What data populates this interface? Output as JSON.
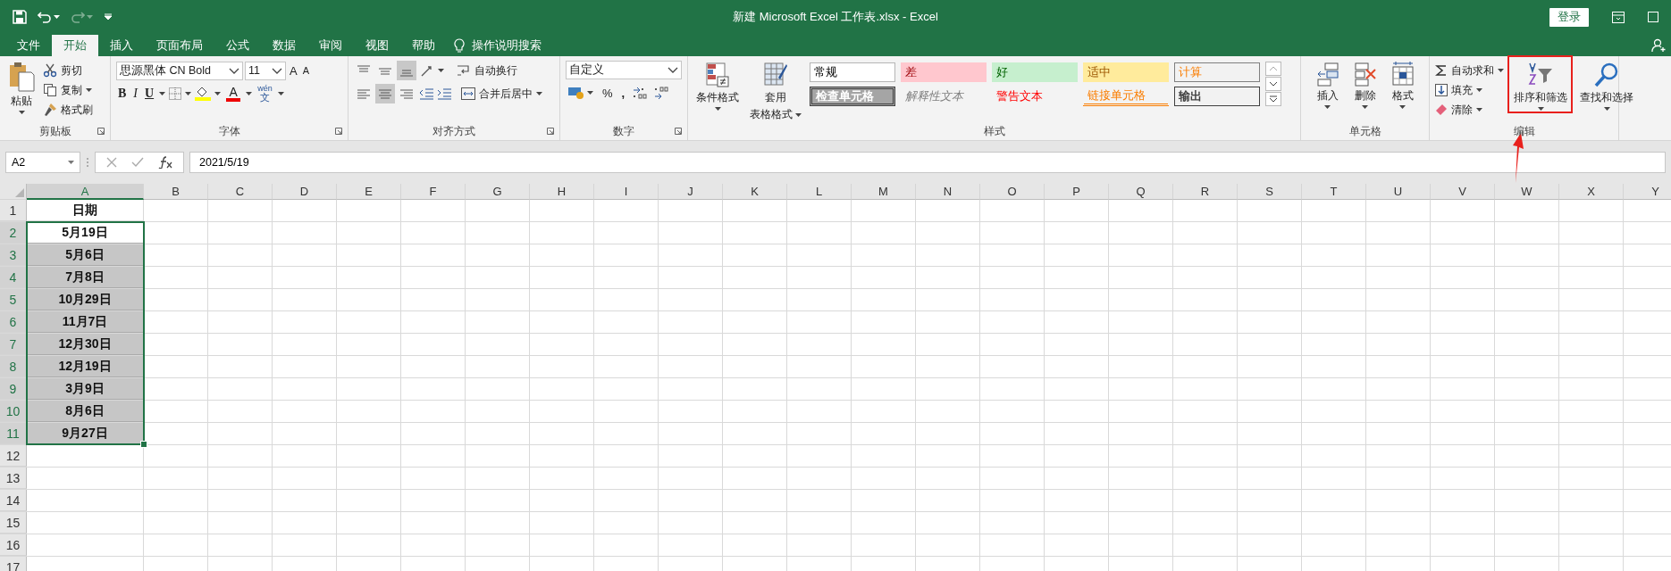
{
  "window": {
    "title": "新建 Microsoft Excel 工作表.xlsx  -  Excel",
    "sign_in": "登录"
  },
  "tabs": [
    {
      "label": "文件",
      "selected": false
    },
    {
      "label": "开始",
      "selected": true
    },
    {
      "label": "插入",
      "selected": false
    },
    {
      "label": "页面布局",
      "selected": false
    },
    {
      "label": "公式",
      "selected": false
    },
    {
      "label": "数据",
      "selected": false
    },
    {
      "label": "审阅",
      "selected": false
    },
    {
      "label": "视图",
      "selected": false
    },
    {
      "label": "帮助",
      "selected": false
    }
  ],
  "tell_me": "操作说明搜索",
  "ribbon": {
    "clipboard": {
      "paste": "粘贴",
      "cut": "剪切",
      "copy": "复制",
      "format_painter": "格式刷",
      "label": "剪贴板"
    },
    "font": {
      "font_name": "思源黑体 CN Bold",
      "font_size": "11",
      "grow": "A",
      "shrink": "A",
      "bold": "B",
      "italic": "I",
      "underline": "U",
      "font_color": "A",
      "phonetic_top": "wén",
      "phonetic_bottom": "文",
      "label": "字体"
    },
    "alignment": {
      "vertical": [
        {
          "selected": false
        },
        {
          "selected": false
        },
        {
          "selected": true
        }
      ],
      "horizontal": [
        {
          "selected": false
        },
        {
          "selected": true
        },
        {
          "selected": false
        }
      ],
      "wrap_text": "自动换行",
      "merge_center": "合并后居中",
      "label": "对齐方式"
    },
    "number": {
      "format": "自定义",
      "percent": "%",
      "comma": ",",
      "label": "数字"
    },
    "styles": {
      "conditional": "条件格式",
      "table_top": "套用",
      "table_bottom": "表格格式",
      "label": "样式",
      "cells": [
        {
          "label": "常规",
          "kind": "normal"
        },
        {
          "label": "差",
          "kind": "bad"
        },
        {
          "label": "好",
          "kind": "good"
        },
        {
          "label": "适中",
          "kind": "neutral"
        },
        {
          "label": "计算",
          "kind": "calc"
        },
        {
          "label": "检查单元格",
          "kind": "check"
        },
        {
          "label": "解释性文本",
          "kind": "explanatory"
        },
        {
          "label": "警告文本",
          "kind": "warning"
        },
        {
          "label": "链接单元格",
          "kind": "linked"
        },
        {
          "label": "输出",
          "kind": "output"
        }
      ]
    },
    "cells": {
      "insert": "插入",
      "delete": "删除",
      "format": "格式",
      "label": "单元格"
    },
    "editing": {
      "autosum": "自动求和",
      "fill": "填充",
      "clear": "清除",
      "sort_filter": "排序和筛选",
      "find_select": "查找和选择",
      "label": "编辑"
    }
  },
  "formula_bar": {
    "name_box": "A2",
    "formula": "2021/5/19"
  },
  "grid": {
    "columns": [
      {
        "label": "A",
        "selected": true
      },
      {
        "label": "B",
        "selected": false
      },
      {
        "label": "C",
        "selected": false
      },
      {
        "label": "D",
        "selected": false
      },
      {
        "label": "E",
        "selected": false
      },
      {
        "label": "F",
        "selected": false
      },
      {
        "label": "G",
        "selected": false
      },
      {
        "label": "H",
        "selected": false
      },
      {
        "label": "I",
        "selected": false
      },
      {
        "label": "J",
        "selected": false
      },
      {
        "label": "K",
        "selected": false
      },
      {
        "label": "L",
        "selected": false
      },
      {
        "label": "M",
        "selected": false
      },
      {
        "label": "N",
        "selected": false
      },
      {
        "label": "O",
        "selected": false
      },
      {
        "label": "P",
        "selected": false
      },
      {
        "label": "Q",
        "selected": false
      },
      {
        "label": "R",
        "selected": false
      },
      {
        "label": "S",
        "selected": false
      },
      {
        "label": "T",
        "selected": false
      },
      {
        "label": "U",
        "selected": false
      },
      {
        "label": "V",
        "selected": false
      },
      {
        "label": "W",
        "selected": false
      },
      {
        "label": "X",
        "selected": false
      },
      {
        "label": "Y",
        "selected": false
      }
    ],
    "rows": [
      {
        "number": "1",
        "value": "日期",
        "selected": false,
        "active": false
      },
      {
        "number": "2",
        "value": "5月19日",
        "selected": true,
        "active": true
      },
      {
        "number": "3",
        "value": "5月6日",
        "selected": true,
        "active": false
      },
      {
        "number": "4",
        "value": "7月8日",
        "selected": true,
        "active": false
      },
      {
        "number": "5",
        "value": "10月29日",
        "selected": true,
        "active": false
      },
      {
        "number": "6",
        "value": "11月7日",
        "selected": true,
        "active": false
      },
      {
        "number": "7",
        "value": "12月30日",
        "selected": true,
        "active": false
      },
      {
        "number": "8",
        "value": "12月19日",
        "selected": true,
        "active": false
      },
      {
        "number": "9",
        "value": "3月9日",
        "selected": true,
        "active": false
      },
      {
        "number": "10",
        "value": "8月6日",
        "selected": true,
        "active": false
      },
      {
        "number": "11",
        "value": "9月27日",
        "selected": true,
        "active": false
      },
      {
        "number": "12",
        "selected": false
      },
      {
        "number": "13",
        "selected": false
      },
      {
        "number": "14",
        "selected": false
      },
      {
        "number": "15",
        "selected": false
      },
      {
        "number": "16",
        "selected": false
      },
      {
        "number": "17",
        "selected": false
      }
    ]
  }
}
